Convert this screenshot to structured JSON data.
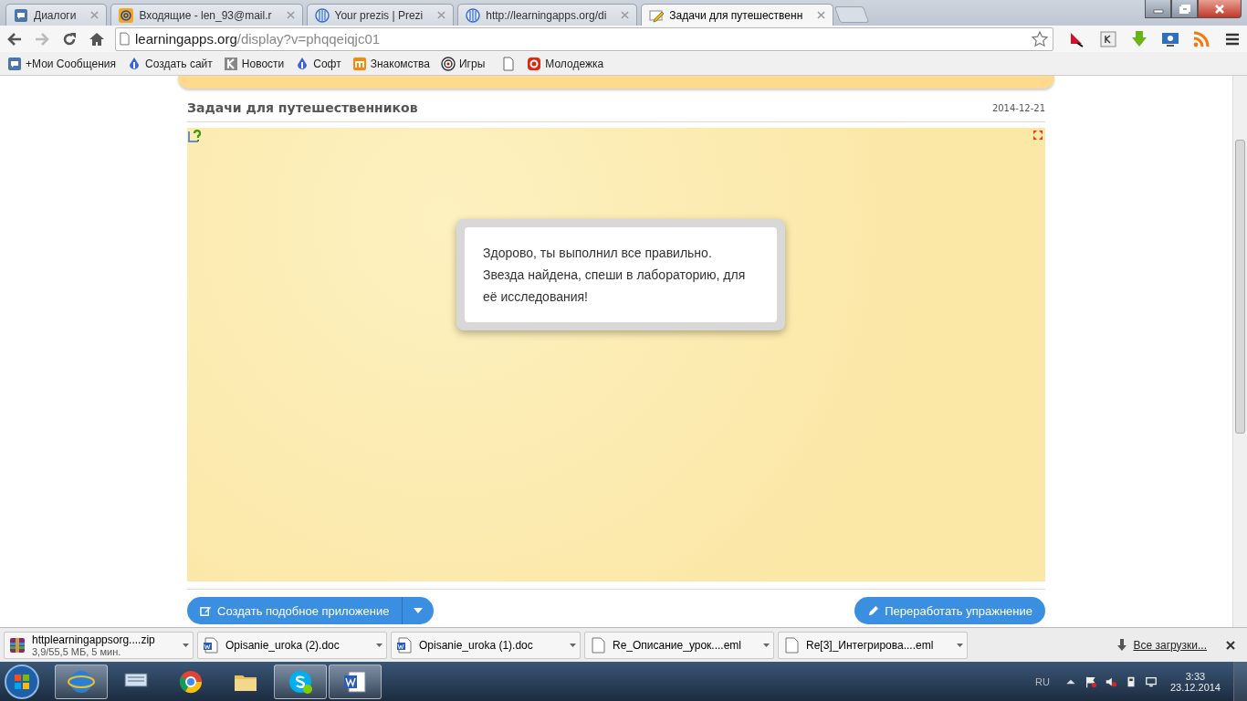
{
  "tabs": [
    {
      "title": "Диалоги",
      "kind": "chat",
      "selected": false
    },
    {
      "title": "Входящие - len_93@mail.r",
      "kind": "mail",
      "selected": false
    },
    {
      "title": "Your prezis | Prezi",
      "kind": "globe",
      "selected": false
    },
    {
      "title": "http://learningapps.org/di",
      "kind": "globe",
      "selected": false
    },
    {
      "title": "Задачи для путешественн",
      "kind": "pencil",
      "selected": true
    }
  ],
  "address": {
    "host": "learningapps.org",
    "path": "/display?v=phqqeiqjc01"
  },
  "bookmarks": [
    {
      "label": "+Мои Сообщения",
      "kind": "chat"
    },
    {
      "label": "Создать сайт",
      "kind": "drop"
    },
    {
      "label": "Новости",
      "kind": "k"
    },
    {
      "label": "Софт",
      "kind": "drop"
    },
    {
      "label": "Знакомства",
      "kind": "m"
    },
    {
      "label": "Игры",
      "kind": "target"
    },
    {
      "label": "Молодежка",
      "kind": "bc"
    }
  ],
  "page": {
    "title": "Задачи для путешественников",
    "date": "2014-12-21",
    "message": "Здорово, ты выполнил все правильно. Звезда найдена, спеши в лабораторию, для её исследования!",
    "buttons": [
      {
        "label": "Создать подобное приложение",
        "kind": "split"
      },
      {
        "label": "Переработать упражнение",
        "kind": "edit"
      }
    ]
  },
  "downloads": [
    {
      "name": "httplearningappsorg....zip",
      "status": "3,9/55,5 МБ, 5 мин.",
      "kind": "zip"
    },
    {
      "name": "Opisanie_uroka (2).doc",
      "kind": "doc"
    },
    {
      "name": "Opisanie_uroka (1).doc",
      "kind": "doc"
    },
    {
      "name": "Re_Описание_урок....eml",
      "kind": "file"
    },
    {
      "name": "Re[3]_Интегрирова....eml",
      "kind": "file"
    }
  ],
  "all_downloads": "Все загрузки...",
  "taskbar": {
    "apps": [
      {
        "kind": "ie",
        "selected": true
      },
      {
        "kind": "keyboard",
        "selected": false
      },
      {
        "kind": "chrome",
        "selected": false
      },
      {
        "kind": "folder",
        "selected": false
      },
      {
        "kind": "skype",
        "selected": true
      },
      {
        "kind": "word",
        "selected": true
      }
    ],
    "lang": "RU",
    "time": "3:33",
    "date": "23.12.2014"
  }
}
